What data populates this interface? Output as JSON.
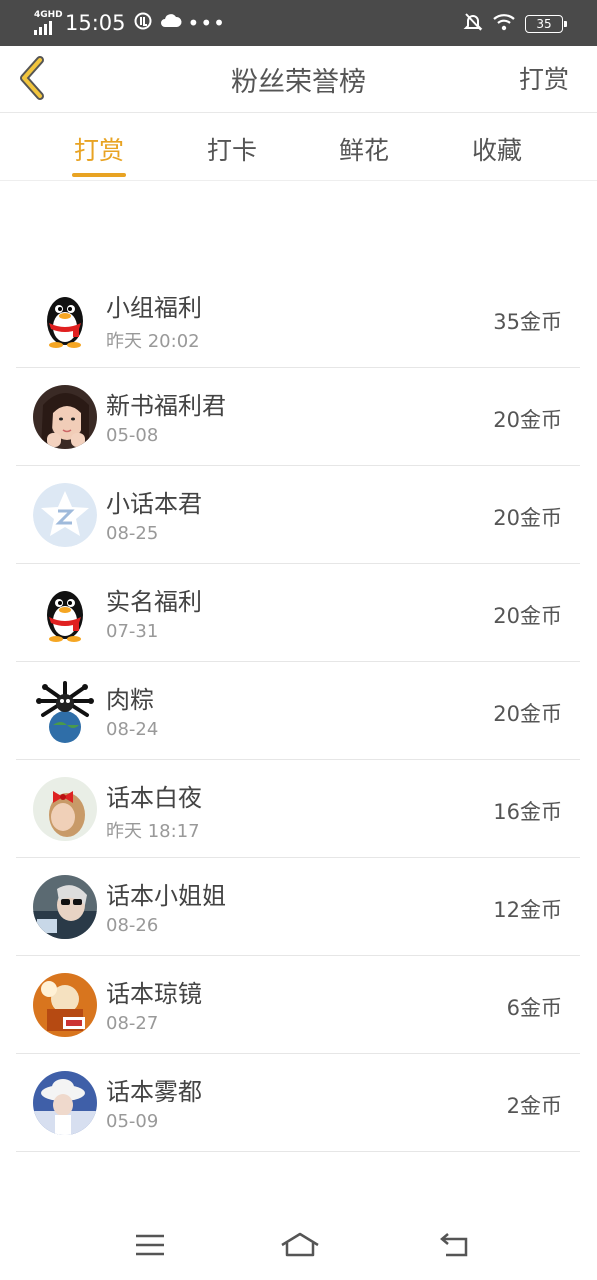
{
  "status_bar": {
    "network": "4GHD",
    "time": "15:05",
    "battery": "35"
  },
  "header": {
    "title": "粉丝荣誉榜",
    "action_label": "打赏"
  },
  "tabs": [
    {
      "label": "打赏",
      "active": true
    },
    {
      "label": "打卡",
      "active": false
    },
    {
      "label": "鲜花",
      "active": false
    },
    {
      "label": "收藏",
      "active": false
    }
  ],
  "colors": {
    "accent": "#e8a323",
    "status_bar": "#4a4a4a"
  },
  "fans": [
    {
      "name": "小组福利",
      "date": "昨天 20:02",
      "amount": "35金币",
      "avatar": "qq-penguin-icon"
    },
    {
      "name": "新书福利君",
      "date": "05-08",
      "amount": "20金币",
      "avatar": "girl-photo"
    },
    {
      "name": "小话本君",
      "date": "08-25",
      "amount": "20金币",
      "avatar": "qzone-star-icon"
    },
    {
      "name": "实名福利",
      "date": "07-31",
      "amount": "20金币",
      "avatar": "qq-penguin-icon"
    },
    {
      "name": "肉粽",
      "date": "08-24",
      "amount": "20金币",
      "avatar": "globe-spider-icon"
    },
    {
      "name": "话本白夜",
      "date": "昨天 18:17",
      "amount": "16金币",
      "avatar": "red-bow-photo"
    },
    {
      "name": "话本小姐姐",
      "date": "08-26",
      "amount": "12金币",
      "avatar": "sunglasses-photo"
    },
    {
      "name": "话本琼镜",
      "date": "08-27",
      "amount": "6金币",
      "avatar": "cartoon-photo"
    },
    {
      "name": "话本雾都",
      "date": "05-09",
      "amount": "2金币",
      "avatar": "white-hat-photo"
    }
  ]
}
